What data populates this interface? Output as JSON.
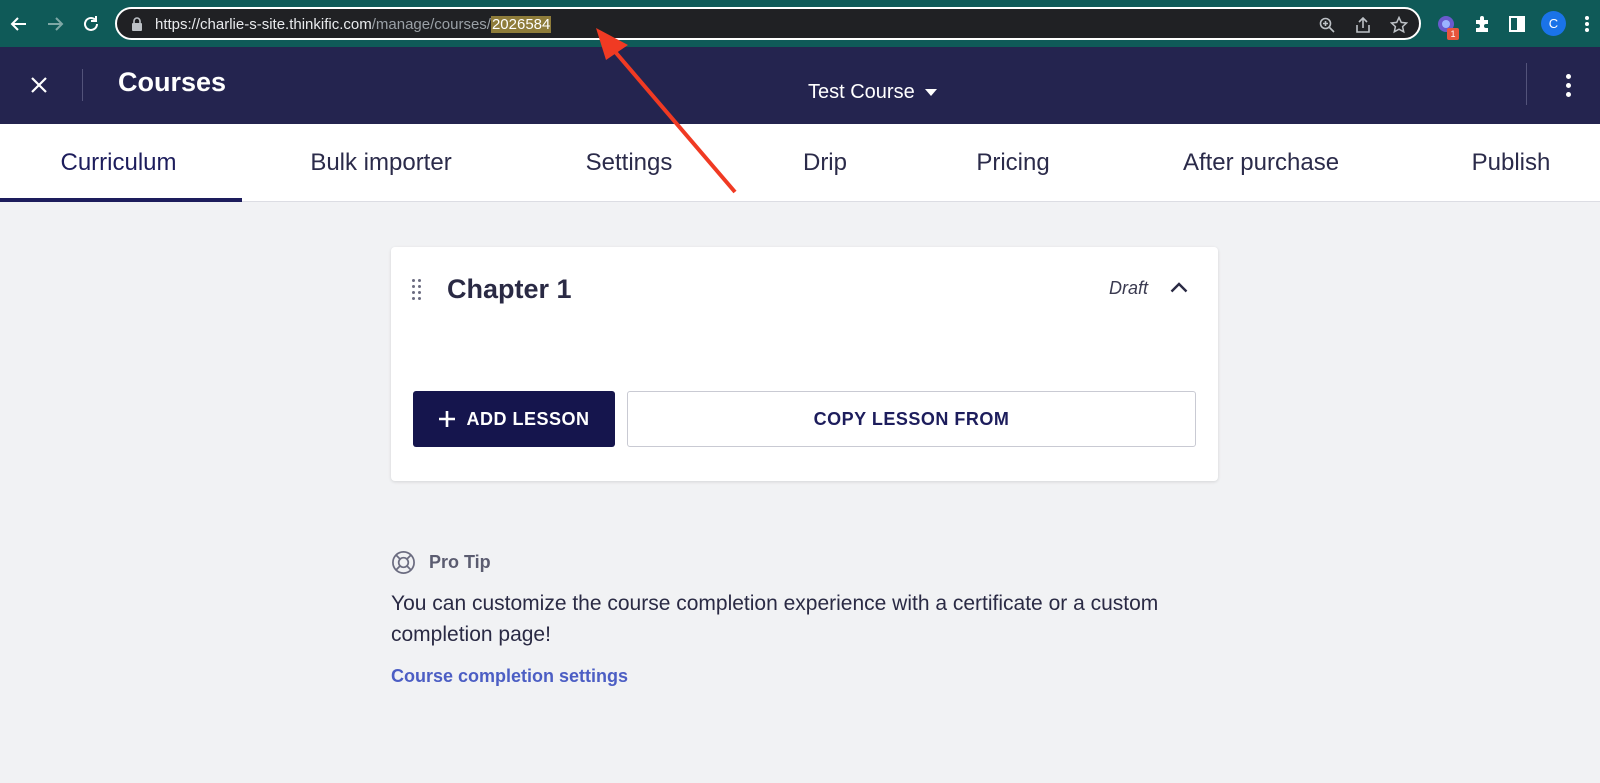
{
  "browser": {
    "url_host": "https://charlie-s-site.thinkific.com",
    "url_path": "/manage/courses/",
    "url_highlight": "2026584",
    "extension_badge": "1",
    "profile_initial": "C",
    "icons": [
      "back-icon",
      "forward-icon",
      "reload-icon",
      "lock-icon",
      "zoom-icon",
      "share-icon",
      "star-icon",
      "extension-icon",
      "puzzle-icon",
      "sidepanel-icon",
      "kebab-icon"
    ]
  },
  "header": {
    "title": "Courses",
    "course_select": "Test Course"
  },
  "tabs": [
    {
      "label": "Curriculum",
      "active": true
    },
    {
      "label": "Bulk importer"
    },
    {
      "label": "Settings"
    },
    {
      "label": "Drip"
    },
    {
      "label": "Pricing"
    },
    {
      "label": "After purchase"
    },
    {
      "label": "Publish"
    }
  ],
  "chapter": {
    "title": "Chapter 1",
    "status": "Draft",
    "add_lesson_label": "ADD LESSON",
    "copy_lesson_label": "COPY LESSON FROM"
  },
  "pro_tip": {
    "label": "Pro Tip",
    "text": "You can customize the course completion experience with a certificate or a custom completion page!",
    "link": "Course completion settings"
  },
  "colors": {
    "header_bg": "#24244f",
    "primary": "#15154d",
    "link": "#4c5ec4",
    "annotation_arrow": "#f03a23"
  }
}
